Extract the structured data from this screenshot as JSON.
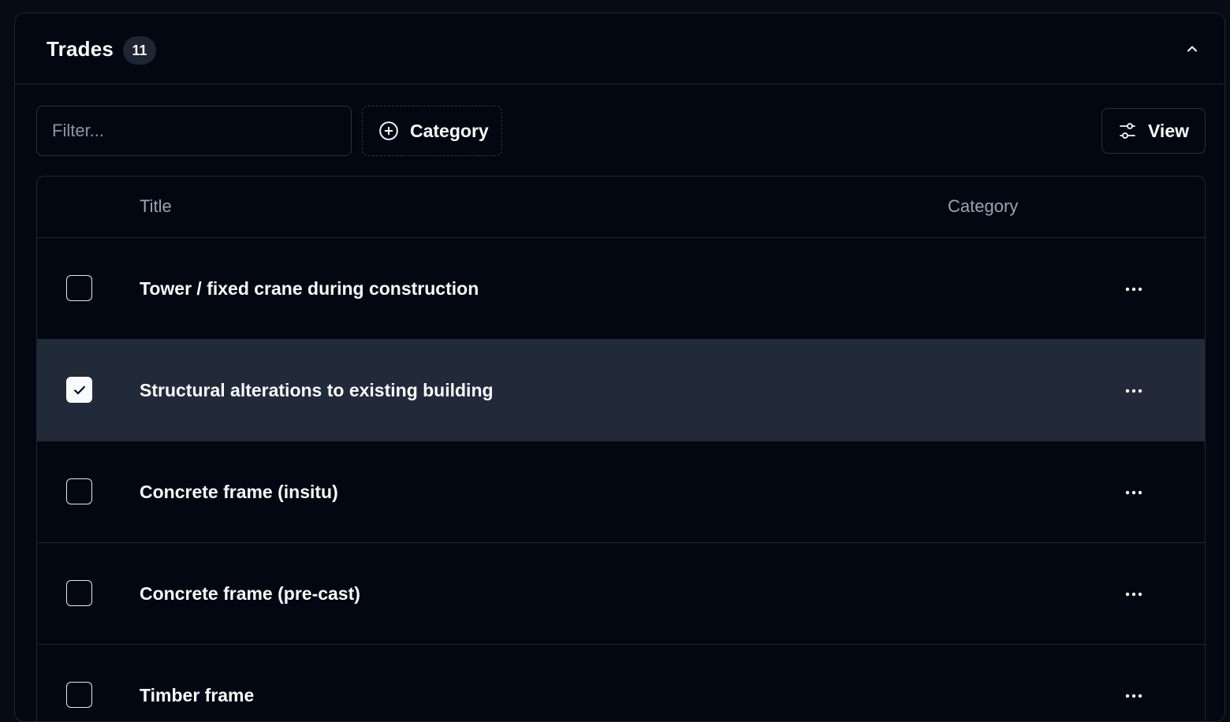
{
  "header": {
    "title": "Trades",
    "count": "11"
  },
  "toolbar": {
    "filter_placeholder": "Filter...",
    "filter_value": "",
    "category_label": "Category",
    "view_label": "View"
  },
  "table": {
    "columns": [
      "Title",
      "Category"
    ],
    "rows": [
      {
        "title": "Tower / fixed crane during construction",
        "category": "",
        "checked": false
      },
      {
        "title": "Structural alterations to existing building",
        "category": "",
        "checked": true
      },
      {
        "title": "Concrete frame (insitu)",
        "category": "",
        "checked": false
      },
      {
        "title": "Concrete frame (pre-cast)",
        "category": "",
        "checked": false
      },
      {
        "title": "Timber frame",
        "category": "",
        "checked": false
      }
    ]
  },
  "icons": {
    "collapse": "chevron-up-icon",
    "category": "plus-circle-icon",
    "view": "sliders-icon",
    "row_menu": "more-horizontal-icon",
    "check": "check-icon"
  }
}
